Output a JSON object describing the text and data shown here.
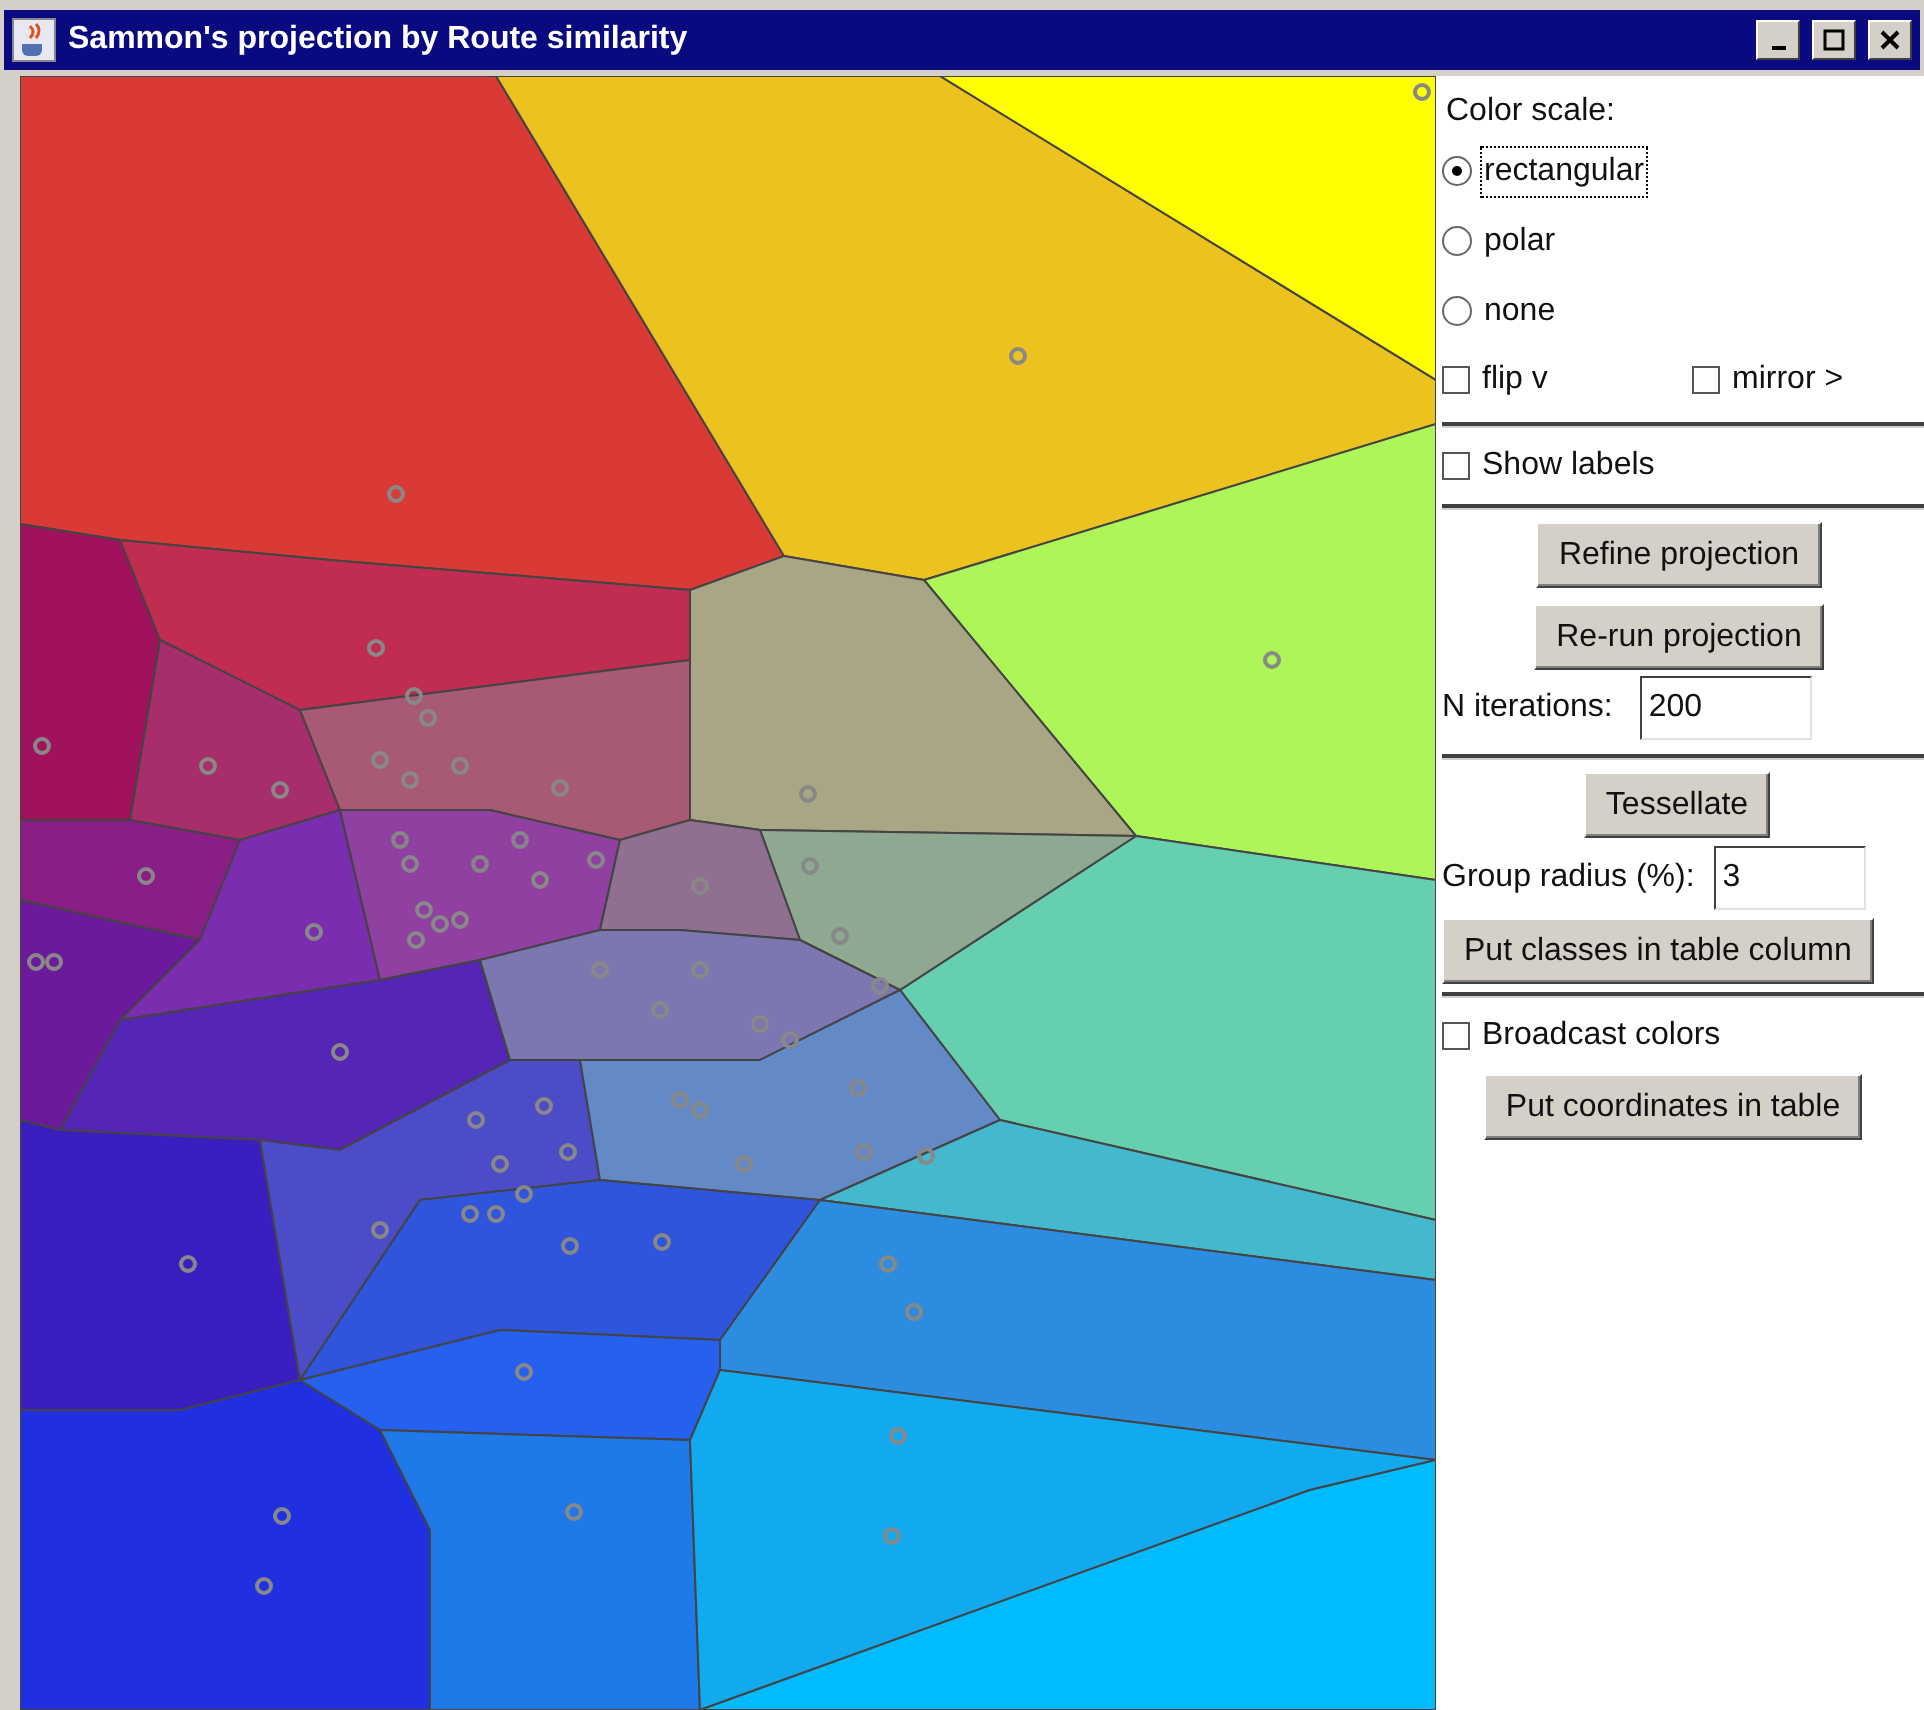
{
  "window": {
    "title": "Sammon's projection by Route similarity"
  },
  "color_scale": {
    "label": "Color scale:",
    "options": [
      {
        "label": "rectangular",
        "selected": true,
        "focused": true
      },
      {
        "label": "polar",
        "selected": false,
        "focused": false
      },
      {
        "label": "none",
        "selected": false,
        "focused": false
      }
    ]
  },
  "orientation": [
    {
      "label": "flip v",
      "checked": false
    },
    {
      "label": "mirror >",
      "checked": false
    }
  ],
  "show_labels": {
    "label": "Show labels",
    "checked": false
  },
  "projection": {
    "buttons": [
      "Refine projection",
      "Re-run projection"
    ],
    "iterations": {
      "label": "N iterations:",
      "value": "200"
    }
  },
  "tessellation": {
    "button": "Tessellate",
    "radius": {
      "label": "Group radius (%):",
      "value": "3"
    },
    "classes_button": "Put classes in table column"
  },
  "broadcast": {
    "label": "Broadcast colors",
    "checked": false
  },
  "coordinates_button": "Put coordinates in table"
}
